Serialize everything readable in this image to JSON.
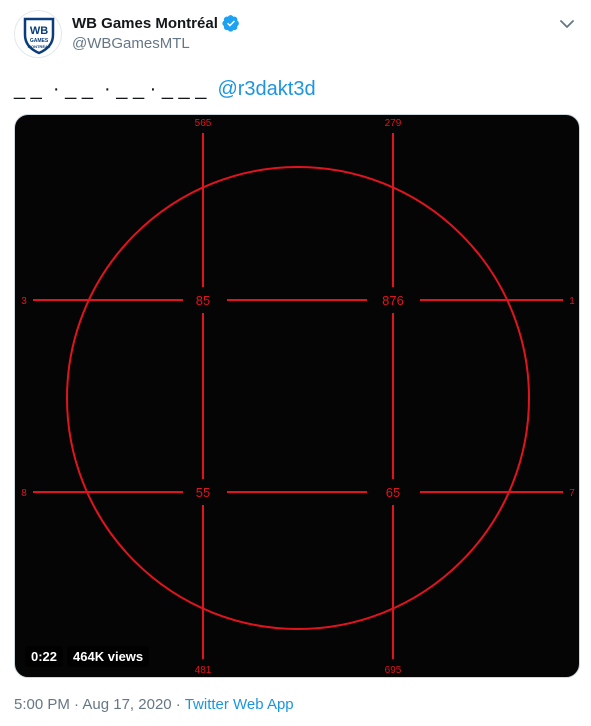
{
  "author": {
    "display_name": "WB Games Montréal",
    "handle": "@WBGamesMTL",
    "avatar_logo_text": [
      "WB",
      "GAMES",
      "MONTRÉAL"
    ]
  },
  "tweet": {
    "text_prefix": "_ _  · _ _  · _ _ · _ _ _  ",
    "mention": "@r3dakt3d"
  },
  "media": {
    "labels": {
      "top_left": "565",
      "top_right": "279",
      "left_upper": "3",
      "right_upper": "1",
      "left_lower": "8",
      "right_lower": "7",
      "bottom_left": "481",
      "bottom_right": "695",
      "center_ul": "85",
      "center_ur": "876",
      "center_ll": "55",
      "center_lr": "65"
    },
    "duration": "0:22",
    "views": "464K views"
  },
  "footer": {
    "time": "5:00 PM",
    "separator": " · ",
    "date": "Aug 17, 2020",
    "app": "Twitter Web App"
  },
  "colors": {
    "accent": "#1b95e0",
    "line_red": "#e0141e",
    "verified": "#1da1f2"
  }
}
